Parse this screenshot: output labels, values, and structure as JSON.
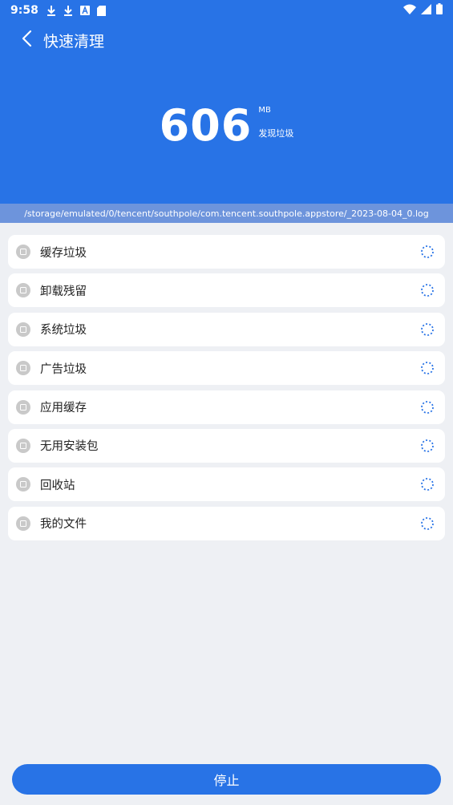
{
  "status_bar": {
    "time": "9:58",
    "icons": [
      "download-icon",
      "download-icon",
      "a-icon",
      "sd-card-icon"
    ],
    "right_icons": [
      "wifi-icon",
      "signal-icon",
      "battery-icon"
    ]
  },
  "header": {
    "title": "快速清理",
    "back_icon": "chevron-left-icon",
    "size_value": "606",
    "size_unit": "MB",
    "size_label": "发现垃圾",
    "background_color": "#2873e6"
  },
  "scan_path": "/storage/emulated/0/tencent/southpole/com.tencent.southpole.appstore/_2023-08-04_0.log",
  "categories": [
    {
      "label": "缓存垃圾",
      "icon": "cache-icon"
    },
    {
      "label": "卸载残留",
      "icon": "uninstall-residue-icon"
    },
    {
      "label": "系统垃圾",
      "icon": "system-junk-icon"
    },
    {
      "label": "广告垃圾",
      "icon": "ad-junk-icon"
    },
    {
      "label": "应用缓存",
      "icon": "app-cache-icon"
    },
    {
      "label": "无用安装包",
      "icon": "apk-icon"
    },
    {
      "label": "回收站",
      "icon": "recycle-bin-icon"
    },
    {
      "label": "我的文件",
      "icon": "folder-icon"
    }
  ],
  "stop_button": {
    "label": "停止"
  },
  "colors": {
    "accent": "#2873e6",
    "path_bar": "#6d94dc",
    "background": "#eef0f4"
  }
}
